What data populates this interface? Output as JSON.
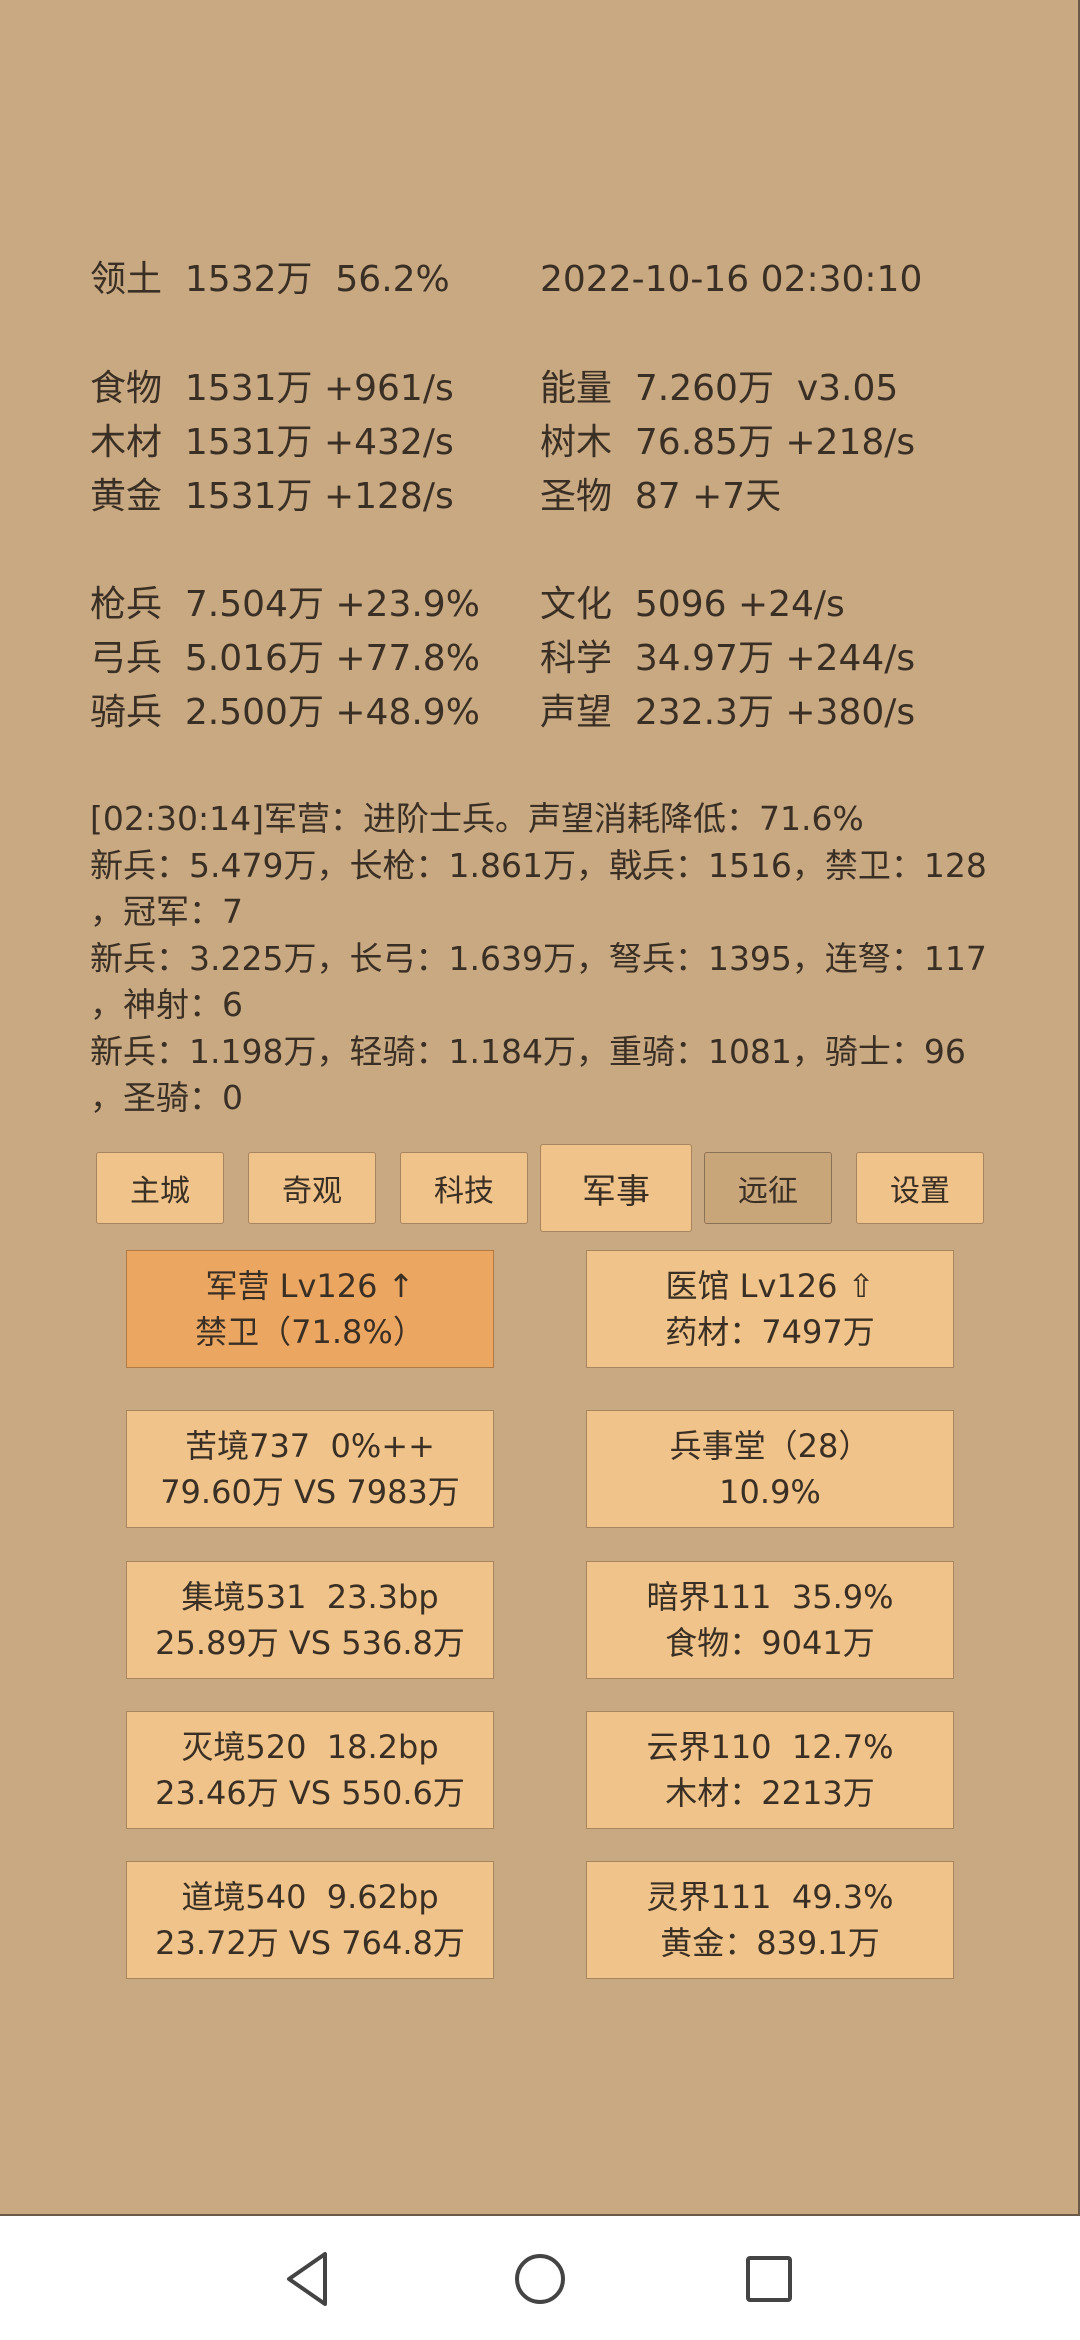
{
  "stats": {
    "territory": "领土  1532万  56.2%",
    "datetime": "2022-10-16 02:30:10",
    "left": [
      "食物  1531万 +961/s",
      "木材  1531万 +432/s",
      "黄金  1531万 +128/s"
    ],
    "right": [
      "能量  7.260万  v3.05",
      "树木  76.85万 +218/s",
      "圣物  87 +7天"
    ],
    "troops": [
      "枪兵  7.504万 +23.9%",
      "弓兵  5.016万 +77.8%",
      "骑兵  2.500万 +48.9%"
    ],
    "culture": [
      "文化  5096 +24/s",
      "科学  34.97万 +244/s",
      "声望  232.3万 +380/s"
    ]
  },
  "log": [
    "[02:30:14]军营：进阶士兵。声望消耗降低：71.6%",
    "新兵：5.479万，长枪：1.861万，戟兵：1516，禁卫：128",
    "，冠军：7",
    "新兵：3.225万，长弓：1.639万，弩兵：1395，连弩：117",
    "，神射：6",
    "新兵：1.198万，轻骑：1.184万，重骑：1081，骑士：96",
    "，圣骑：0"
  ],
  "tabs": [
    "主城",
    "奇观",
    "科技",
    "军事",
    "远征",
    "设置"
  ],
  "cards": [
    {
      "line1": "军营 Lv126 ↑",
      "line2": "禁卫（71.8%）"
    },
    {
      "line1": "医馆 Lv126 ⇧",
      "line2": "药材：7497万"
    },
    {
      "line1": "苦境737  0%++",
      "line2": "79.60万 VS 7983万"
    },
    {
      "line1": "兵事堂（28）",
      "line2": "10.9%"
    },
    {
      "line1": "集境531  23.3bp",
      "line2": "25.89万 VS 536.8万"
    },
    {
      "line1": "暗界111  35.9%",
      "line2": "食物：9041万"
    },
    {
      "line1": "灭境520  18.2bp",
      "line2": "23.46万 VS 550.6万"
    },
    {
      "line1": "云界110  12.7%",
      "line2": "木材：2213万"
    },
    {
      "line1": "道境540  9.62bp",
      "line2": "23.72万 VS 764.8万"
    },
    {
      "line1": "灵界111  49.3%",
      "line2": "黄金：839.1万"
    }
  ],
  "nav": [
    "back-icon",
    "home-icon",
    "recents-icon"
  ]
}
